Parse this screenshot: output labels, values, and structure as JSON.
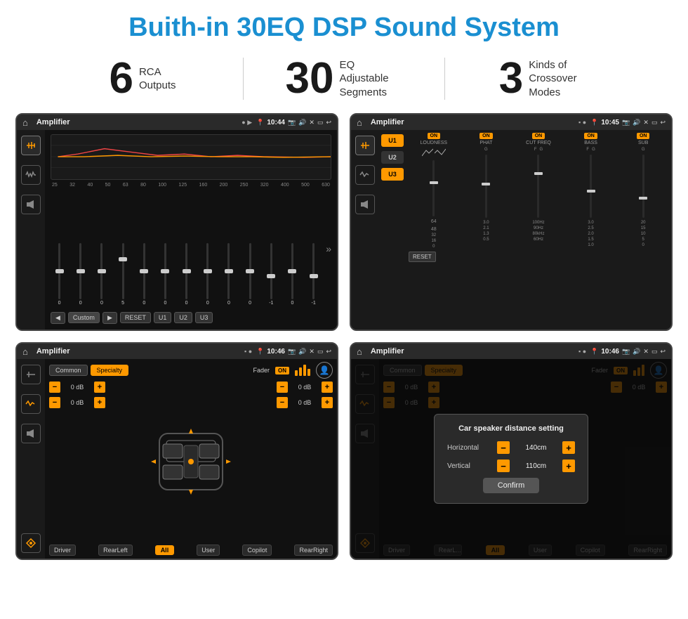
{
  "page": {
    "title": "Buith-in 30EQ DSP Sound System",
    "stats": [
      {
        "number": "6",
        "label": "RCA\nOutputs"
      },
      {
        "number": "30",
        "label": "EQ Adjustable\nSegments"
      },
      {
        "number": "3",
        "label": "Kinds of\nCrossover Modes"
      }
    ]
  },
  "screen1": {
    "title": "Amplifier",
    "time": "10:44",
    "mode": "Custom",
    "freq_labels": [
      "25",
      "32",
      "40",
      "50",
      "63",
      "80",
      "100",
      "125",
      "160",
      "200",
      "250",
      "320",
      "400",
      "500",
      "630"
    ],
    "slider_vals": [
      "0",
      "0",
      "0",
      "5",
      "0",
      "0",
      "0",
      "0",
      "0",
      "0",
      "-1",
      "0",
      "-1"
    ],
    "buttons": [
      "◀",
      "Custom",
      "▶",
      "RESET",
      "U1",
      "U2",
      "U3"
    ]
  },
  "screen2": {
    "title": "Amplifier",
    "time": "10:45",
    "u_buttons": [
      "U1",
      "U2",
      "U3"
    ],
    "controls": [
      {
        "on": true,
        "label": "LOUDNESS",
        "has_g": false
      },
      {
        "on": true,
        "label": "PHAT",
        "has_g": true
      },
      {
        "on": true,
        "label": "CUT FREQ",
        "has_g": true
      },
      {
        "on": true,
        "label": "BASS",
        "has_g": true
      },
      {
        "on": true,
        "label": "SUB",
        "has_g": true
      }
    ],
    "reset_label": "RESET"
  },
  "screen3": {
    "title": "Amplifier",
    "time": "10:46",
    "tabs": [
      "Common",
      "Specialty"
    ],
    "fader": "Fader",
    "fader_on": "ON",
    "db_values": [
      "0 dB",
      "0 dB",
      "0 dB",
      "0 dB"
    ],
    "labels": [
      "Driver",
      "Copilot",
      "RearLeft",
      "All",
      "User",
      "RearRight"
    ]
  },
  "screen4": {
    "title": "Amplifier",
    "time": "10:46",
    "tabs": [
      "Common",
      "Specialty"
    ],
    "dialog": {
      "title": "Car speaker distance setting",
      "horizontal_label": "Horizontal",
      "horizontal_value": "140cm",
      "vertical_label": "Vertical",
      "vertical_value": "110cm",
      "confirm_label": "Confirm"
    },
    "db_values": [
      "0 dB",
      "0 dB"
    ],
    "labels": [
      "Driver",
      "Copilot",
      "RearLeft",
      "All",
      "User",
      "RearRight"
    ]
  }
}
